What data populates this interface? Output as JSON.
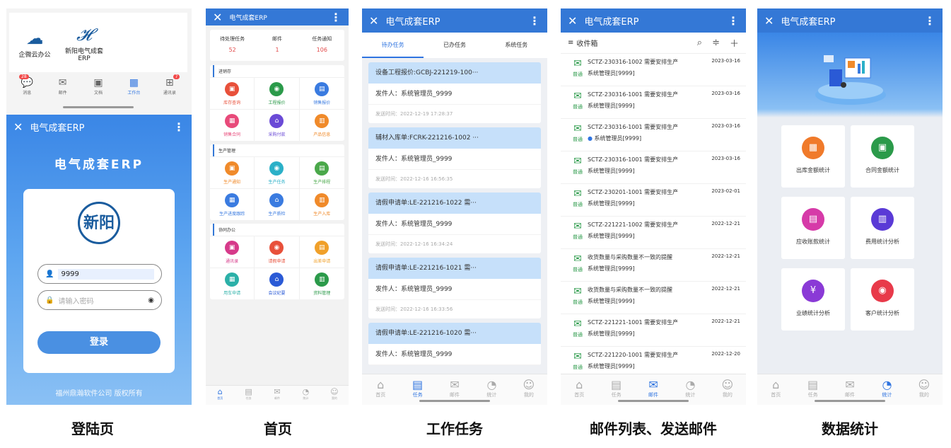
{
  "captions": [
    "登陆页",
    "首页",
    "工作任务",
    "邮件列表、发送邮件",
    "数据统计"
  ],
  "app_title": "电气成套ERP",
  "login": {
    "wecom_apps": [
      {
        "label": "企微云办公",
        "icon": "cloud-icon"
      },
      {
        "label": "新阳电气成套\nERP",
        "icon": "logo-icon"
      }
    ],
    "wecom_nav": [
      {
        "label": "消息",
        "badge": "28"
      },
      {
        "label": "邮件"
      },
      {
        "label": "文档"
      },
      {
        "label": "工作台"
      },
      {
        "label": "通讯录",
        "badge": "7"
      }
    ],
    "heading": "电气成套ERP",
    "logo_text": "新阳",
    "username_value": "9999",
    "password_placeholder": "请输入密码",
    "login_button": "登录",
    "copyright": "福州鼎瀚软件公司 版权所有"
  },
  "home": {
    "counts": [
      {
        "label": "待处理任务",
        "value": "52"
      },
      {
        "label": "邮件",
        "value": "1"
      },
      {
        "label": "任务通知",
        "value": "106"
      }
    ],
    "sections": [
      {
        "title": "进销存",
        "items": [
          {
            "label": "库存查询",
            "color": "#e8503a"
          },
          {
            "label": "工程报价",
            "color": "#2b9a4a"
          },
          {
            "label": "销售报价",
            "color": "#3a7be0"
          },
          {
            "label": "销售合同",
            "color": "#e84a7a"
          },
          {
            "label": "采购付款",
            "color": "#6a4ad6"
          },
          {
            "label": "产品信息",
            "color": "#f08a2a"
          }
        ]
      },
      {
        "title": "生产管理",
        "items": [
          {
            "label": "生产通知",
            "color": "#f08a2a"
          },
          {
            "label": "生产任务",
            "color": "#2bb0c8"
          },
          {
            "label": "生产排程",
            "color": "#4aa84a"
          },
          {
            "label": "生产进度跟踪",
            "color": "#3a7be0"
          },
          {
            "label": "生产质检",
            "color": "#3a7be0"
          },
          {
            "label": "生产入库",
            "color": "#f08a2a"
          }
        ]
      },
      {
        "title": "协同办公",
        "items": [
          {
            "label": "通讯录",
            "color": "#d63a8a"
          },
          {
            "label": "请假申请",
            "color": "#e8503a"
          },
          {
            "label": "出差申请",
            "color": "#f0a02a"
          },
          {
            "label": "用车申请",
            "color": "#2bb0a8"
          },
          {
            "label": "会议纪要",
            "color": "#2a5ad6"
          },
          {
            "label": "资料管理",
            "color": "#2b9a4a"
          }
        ]
      }
    ],
    "tabbar": [
      "首页",
      "任务",
      "邮件",
      "统计",
      "我的"
    ]
  },
  "tasks": {
    "tabs": [
      "待办任务",
      "已办任务",
      "系统任务"
    ],
    "items": [
      {
        "title": "设备工程报价:GCBJ-221219-100···",
        "sender": "发件人：系统管理员_9999",
        "time": "发送时间：2022-12-19 17:28:37"
      },
      {
        "title": "辅材入库单:FCRK-221216-1002 ···",
        "sender": "发件人：系统管理员_9999",
        "time": "发送时间：2022-12-16 16:56:35"
      },
      {
        "title": "请假申请单:LE-221216-1022 需···",
        "sender": "发件人：系统管理员_9999",
        "time": "发送时间：2022-12-16 16:34:24"
      },
      {
        "title": "请假申请单:LE-221216-1021 需···",
        "sender": "发件人：系统管理员_9999",
        "time": "发送时间：2022-12-16 16:33:56"
      },
      {
        "title": "请假申请单:LE-221216-1020 需···",
        "sender": "发件人：系统管理员_9999",
        "time": ""
      }
    ],
    "tabbar": [
      "首页",
      "任务",
      "邮件",
      "统计",
      "我的"
    ]
  },
  "mail": {
    "header": "收件箱",
    "tag": "普通",
    "items": [
      {
        "subject": "SCTZ-230316-1002 需要安排生产",
        "from": "系统管理员[9999]",
        "date": "2023-03-16"
      },
      {
        "subject": "SCTZ-230316-1001 需要安排生产",
        "from": "系统管理员[9999]",
        "date": "2023-03-16"
      },
      {
        "subject": "SCTZ-230316-1001 需要安排生产",
        "from": "系统管理员[9999]",
        "date": "2023-03-16",
        "unread": true
      },
      {
        "subject": "SCTZ-230316-1001 需要安排生产",
        "from": "系统管理员[9999]",
        "date": "2023-03-16"
      },
      {
        "subject": "SCTZ-230201-1001 需要安排生产",
        "from": "系统管理员[9999]",
        "date": "2023-02-01"
      },
      {
        "subject": "SCTZ-221221-1002 需要安排生产",
        "from": "系统管理员[9999]",
        "date": "2022-12-21"
      },
      {
        "subject": "收货数量与采购数量不一致的提醒",
        "from": "系统管理员[9999]",
        "date": "2022-12-21"
      },
      {
        "subject": "收货数量与采购数量不一致的提醒",
        "from": "系统管理员[9999]",
        "date": "2022-12-21"
      },
      {
        "subject": "SCTZ-221221-1001 需要安排生产",
        "from": "系统管理员[9999]",
        "date": "2022-12-21"
      },
      {
        "subject": "SCTZ-221220-1001 需要安排生产",
        "from": "系统管理员[9999]",
        "date": "2022-12-20"
      }
    ],
    "tabbar": [
      "首页",
      "任务",
      "邮件",
      "统计",
      "我的"
    ]
  },
  "stats": {
    "items": [
      {
        "label": "出库金额统计",
        "color": "#f07a2a"
      },
      {
        "label": "合同金额统计",
        "color": "#2b9a4a"
      },
      {
        "label": "应收账款统计",
        "color": "#d63aa8"
      },
      {
        "label": "费用统计分析",
        "color": "#5a3ad6"
      },
      {
        "label": "业绩统计分析",
        "color": "#8a3ad6"
      },
      {
        "label": "客户统计分析",
        "color": "#e83a4a"
      }
    ],
    "tabbar": [
      "首页",
      "任务",
      "邮件",
      "统计",
      "我的"
    ]
  }
}
